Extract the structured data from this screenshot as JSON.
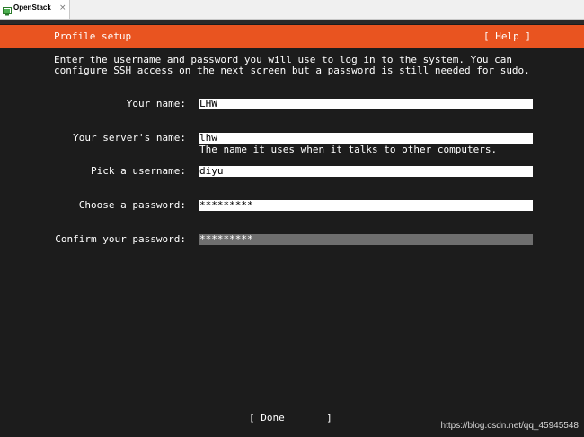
{
  "window": {
    "tab_title": "OpenStack",
    "tab_close": "×"
  },
  "header": {
    "title": "Profile setup",
    "help_label": "[ Help ]"
  },
  "intro_text": "Enter the username and password you will use to log in to the system. You can configure SSH access on the next screen but a password is still needed for sudo.",
  "form": {
    "your_name": {
      "label": "Your name:",
      "value": "LHW"
    },
    "server_name": {
      "label": "Your server's name:",
      "value": "lhw",
      "hint": "The name it uses when it talks to other computers."
    },
    "username": {
      "label": "Pick a username:",
      "value": "diyu"
    },
    "password": {
      "label": "Choose a password:",
      "value": "*********"
    },
    "confirm_password": {
      "label": "Confirm your password:",
      "value": "*********"
    }
  },
  "footer": {
    "done_label": "[ Done       ]"
  },
  "watermark": "https://blog.csdn.net/qq_45945548",
  "colors": {
    "accent": "#e95420",
    "background": "#1c1c1c",
    "focused_field": "#6e6e6e"
  }
}
